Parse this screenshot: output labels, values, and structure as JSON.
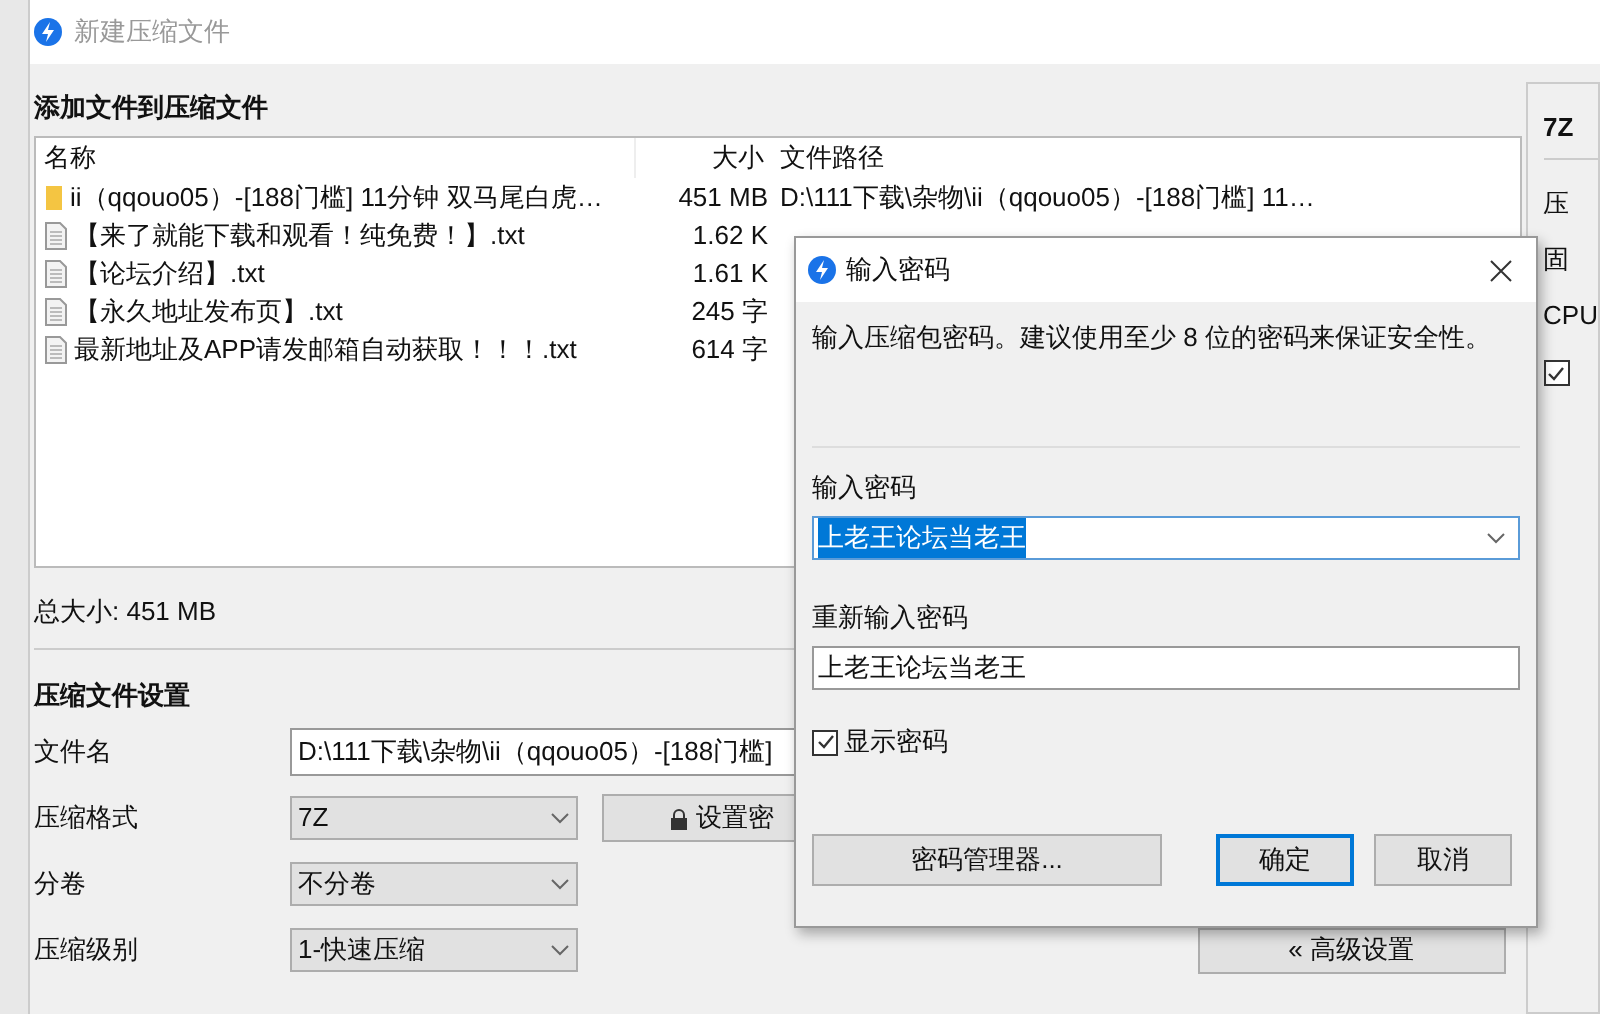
{
  "window": {
    "title": "新建压缩文件"
  },
  "add_section": {
    "heading": "添加文件到压缩文件"
  },
  "file_list": {
    "columns": [
      "名称",
      "大小",
      "文件路径"
    ],
    "rows": [
      {
        "kind": "folder",
        "name": "ii（qqouo05）-[188门槛] 11分钟 双马尾白虎…",
        "size": "451 MB",
        "path": "D:\\111下载\\杂物\\ii（qqouo05）-[188门槛] 11…"
      },
      {
        "kind": "file",
        "name": "【来了就能下载和观看！纯免费！】.txt",
        "size": "1.62 K"
      },
      {
        "kind": "file",
        "name": "【论坛介绍】.txt",
        "size": "1.61 K"
      },
      {
        "kind": "file",
        "name": "【永久地址发布页】.txt",
        "size": "245 字"
      },
      {
        "kind": "file",
        "name": "最新地址及APP请发邮箱自动获取！！！.txt",
        "size": "614 字"
      }
    ]
  },
  "total_size": "总大小: 451 MB",
  "settings": {
    "heading": "压缩文件设置",
    "fields": [
      {
        "kind": "text",
        "label": "文件名",
        "value": "D:\\111下载\\杂物\\ii（qqouo05）-[188门槛]"
      },
      {
        "kind": "select",
        "label": "压缩格式",
        "value": "7Z",
        "button": "设置密"
      },
      {
        "kind": "select",
        "label": "分卷",
        "value": "不分卷"
      },
      {
        "kind": "select",
        "label": "压缩级别",
        "value": "1-快速压缩"
      }
    ],
    "advanced_button": "« 高级设置"
  },
  "side_panel": {
    "title": "7Z",
    "labels": [
      "压",
      "固",
      "CPU"
    ],
    "checkbox_checked": true
  },
  "dialog": {
    "title": "输入密码",
    "message": "输入压缩包密码。建议使用至少 8 位的密码来保证安全性。",
    "password_label": "输入密码",
    "password_value": "上老王论坛当老王",
    "confirm_label": "重新输入密码",
    "confirm_value": "上老王论坛当老王",
    "show_password": {
      "label": "显示密码",
      "checked": true
    },
    "buttons": [
      {
        "kind": "secondary",
        "label": "密码管理器..."
      },
      {
        "kind": "default",
        "label": "确定"
      },
      {
        "kind": "secondary",
        "label": "取消"
      }
    ]
  }
}
